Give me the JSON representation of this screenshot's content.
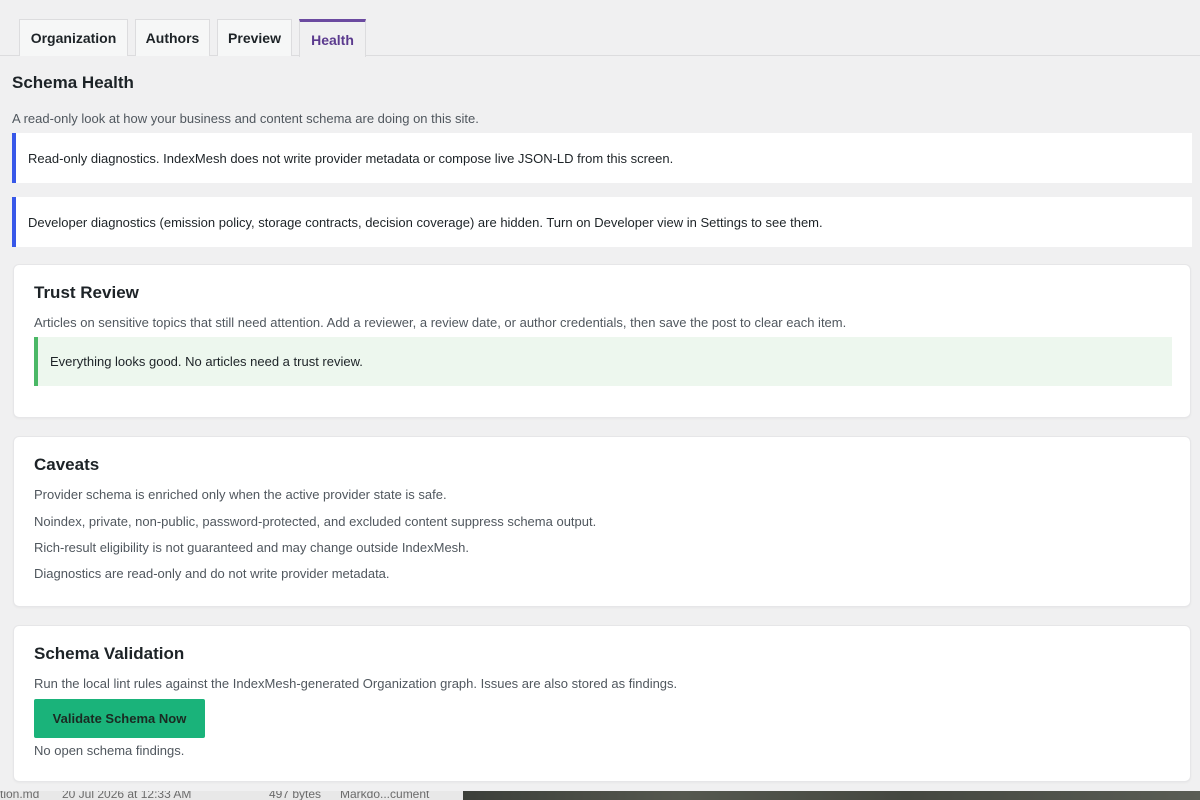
{
  "tabs": [
    {
      "label": "Organization",
      "active": false
    },
    {
      "label": "Authors",
      "active": false
    },
    {
      "label": "Preview",
      "active": false
    },
    {
      "label": "Health",
      "active": true
    }
  ],
  "page": {
    "title": "Schema Health",
    "description": "A read-only look at how your business and content schema are doing on this site."
  },
  "notices": {
    "readonly": "Read-only diagnostics. IndexMesh does not write provider metadata or compose live JSON-LD from this screen.",
    "developer": "Developer diagnostics (emission policy, storage contracts, decision coverage) are hidden. Turn on Developer view in Settings to see them."
  },
  "trust_review": {
    "title": "Trust Review",
    "description": "Articles on sensitive topics that still need attention. Add a reviewer, a review date, or author credentials, then save the post to clear each item.",
    "status": "Everything looks good. No articles need a trust review."
  },
  "caveats": {
    "title": "Caveats",
    "items": [
      "Provider schema is enriched only when the active provider state is safe.",
      "Noindex, private, non-public, password-protected, and excluded content suppress schema output.",
      "Rich-result eligibility is not guaranteed and may change outside IndexMesh.",
      "Diagnostics are read-only and do not write provider metadata."
    ]
  },
  "schema_validation": {
    "title": "Schema Validation",
    "description": "Run the local lint rules against the IndexMesh-generated Organization graph. Issues are also stored as findings.",
    "button_label": "Validate Schema Now",
    "status": "No open schema findings."
  },
  "finder_row": {
    "name": "tion.md",
    "date": "20 Jul 2026 at 12:33 AM",
    "size": "497 bytes",
    "kind": "Markdo...cument"
  },
  "colors": {
    "accent_tab": "#6b4aa0",
    "notice_border": "#3858e9",
    "success_border": "#4ab866",
    "button_bg": "#1ab37a"
  }
}
